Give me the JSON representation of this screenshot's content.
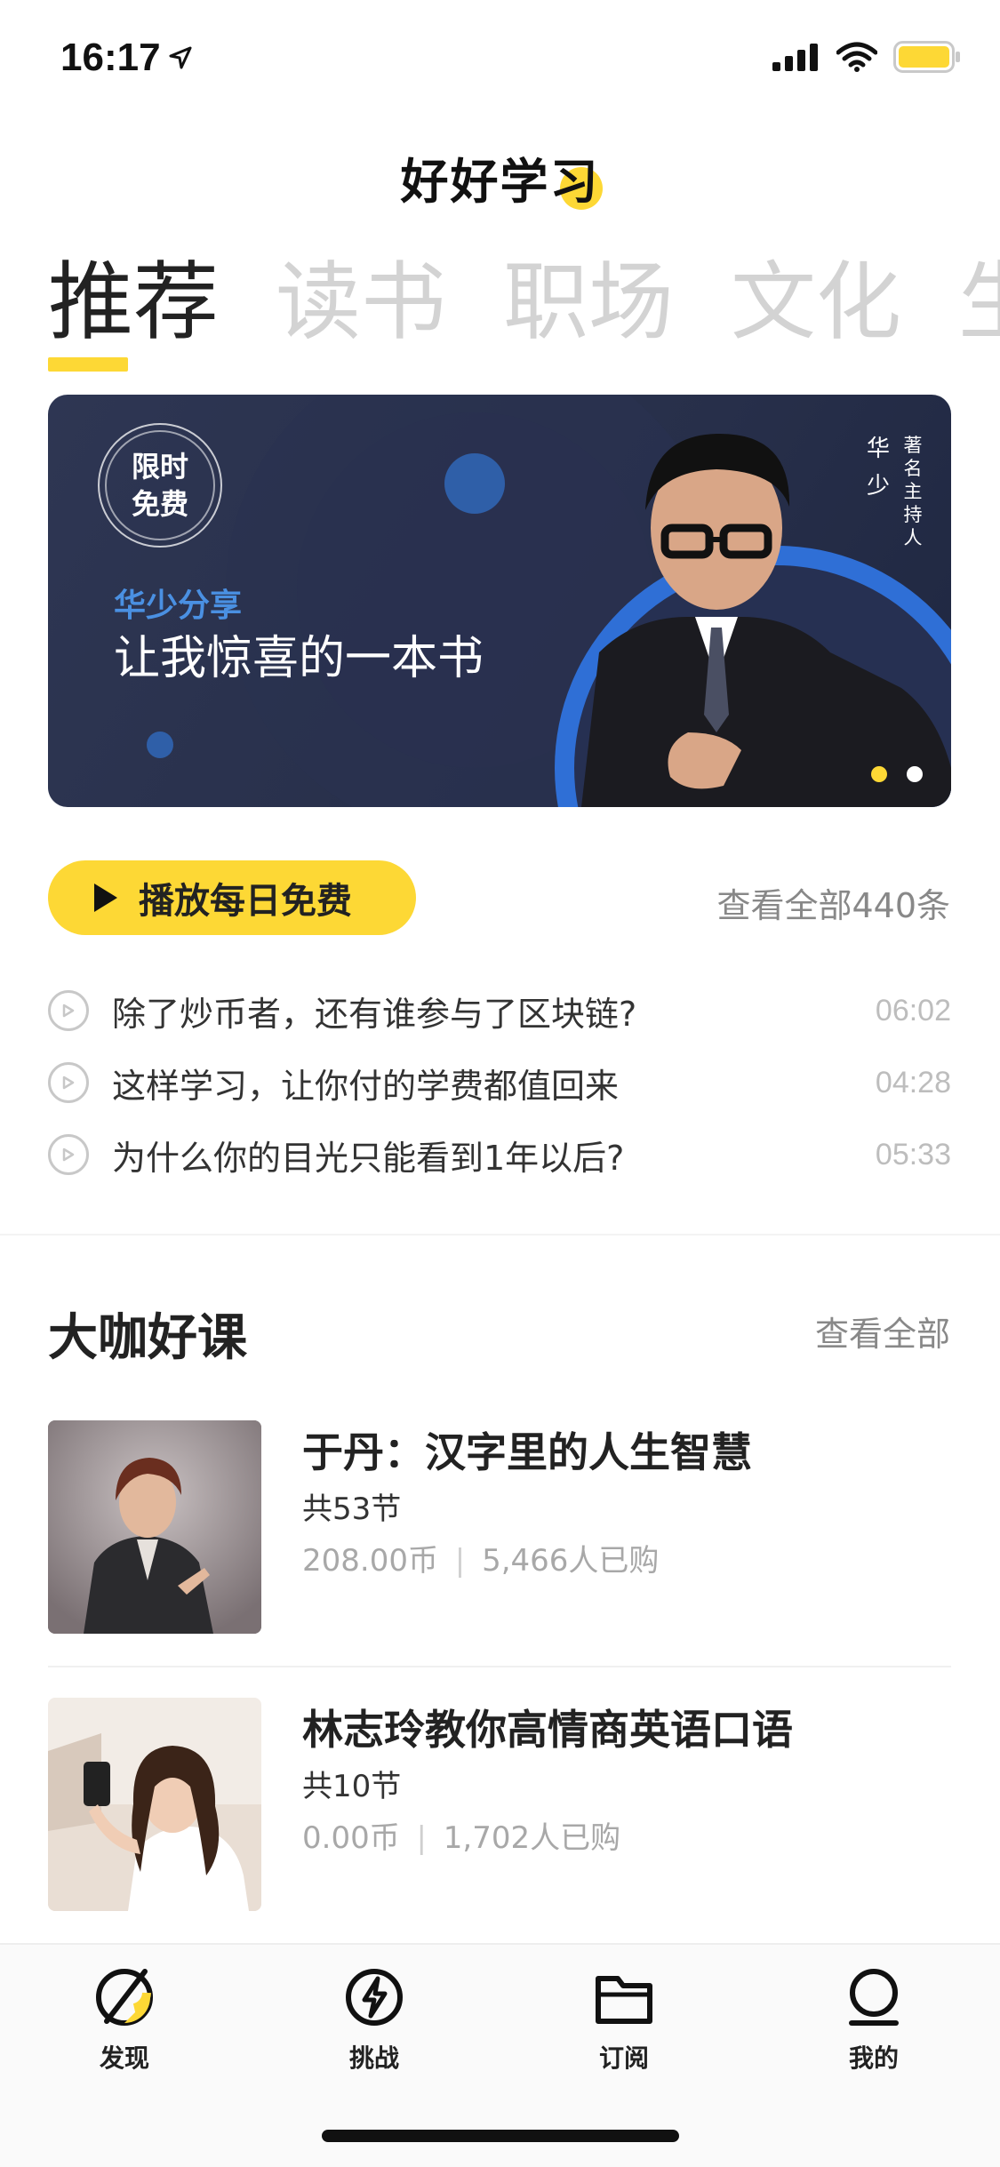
{
  "status_bar": {
    "time": "16:17"
  },
  "header": {
    "app_title": "好好学习"
  },
  "tabs": [
    {
      "label": "推荐",
      "active": true
    },
    {
      "label": "读书",
      "active": false
    },
    {
      "label": "职场",
      "active": false
    },
    {
      "label": "文化",
      "active": false
    },
    {
      "label": "生",
      "active": false
    }
  ],
  "banner": {
    "badge_line1": "限时",
    "badge_line2": "免费",
    "subtitle": "华少分享",
    "title": "让我惊喜的一本书",
    "person_name": "华少",
    "person_role": "著名主持人",
    "page_index": 1,
    "page_count": 2,
    "accent_color": "#FDD835",
    "subtitle_color": "#4A90E2"
  },
  "daily": {
    "play_label": "播放每日免费",
    "view_all_label": "查看全部440条",
    "episodes": [
      {
        "title": "除了炒币者，还有谁参与了区块链?",
        "duration": "06:02"
      },
      {
        "title": "这样学习，让你付的学费都值回来",
        "duration": "04:28"
      },
      {
        "title": "为什么你的目光只能看到1年以后?",
        "duration": "05:33"
      }
    ]
  },
  "courses_section": {
    "title": "大咖好课",
    "view_all_label": "查看全部",
    "items": [
      {
        "title": "于丹：汉字里的人生智慧",
        "lessons": "共53节",
        "price": "208.00币",
        "buyers": "5,466人已购"
      },
      {
        "title": "林志玲教你高情商英语口语",
        "lessons": "共10节",
        "price": "0.00币",
        "buyers": "1,702人已购"
      }
    ]
  },
  "bottom_nav": {
    "items": [
      {
        "label": "发现",
        "icon": "compass-icon",
        "active": true
      },
      {
        "label": "挑战",
        "icon": "lightning-icon",
        "active": false
      },
      {
        "label": "订阅",
        "icon": "folder-icon",
        "active": false
      },
      {
        "label": "我的",
        "icon": "person-icon",
        "active": false
      }
    ]
  }
}
